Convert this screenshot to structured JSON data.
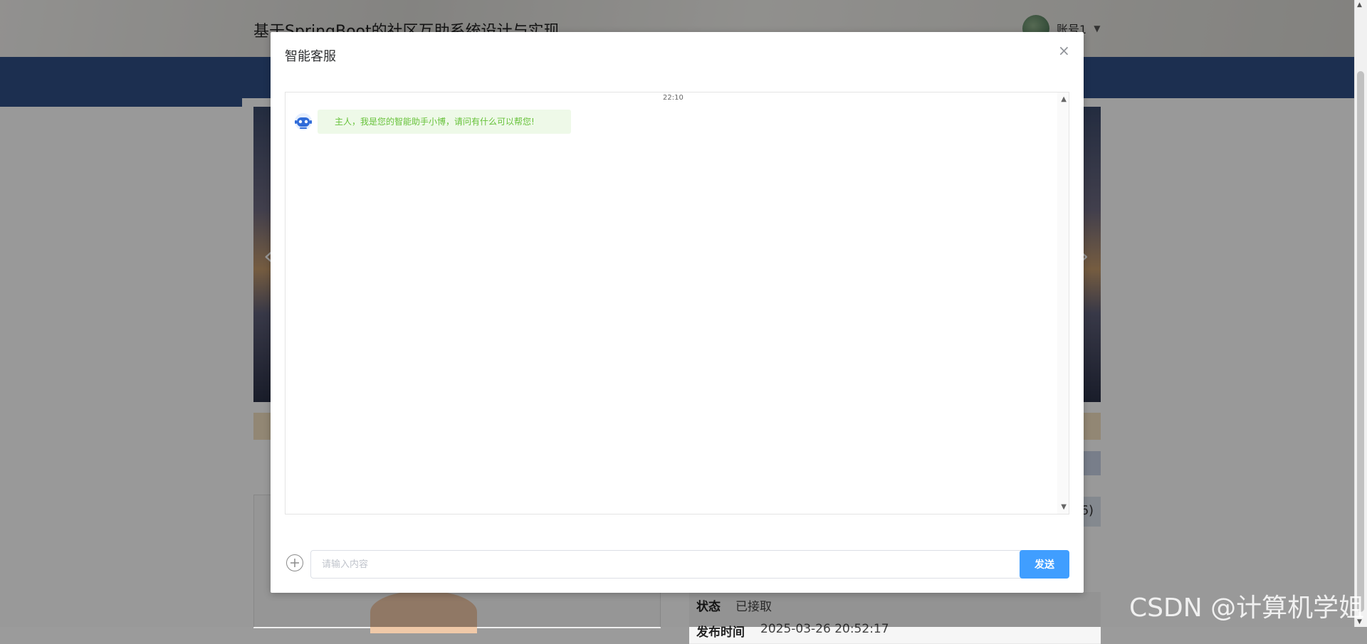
{
  "background": {
    "site_title": "基于SpringBoot的社区互助系统设计与实现",
    "user": {
      "name": "账号1",
      "caret": "▼"
    },
    "info_number": "6)",
    "info_rows": [
      {
        "label": "状态",
        "value": "已接取"
      },
      {
        "label": "发布时间",
        "value": "2025-03-26 20:52:17"
      }
    ]
  },
  "modal": {
    "title": "智能客服",
    "close_glyph": "×",
    "chat": {
      "time": "22:10",
      "messages": [
        {
          "from": "bot",
          "text": "主人，我是您的智能助手小博，请问有什么可以帮您!"
        }
      ]
    },
    "input_placeholder": "请输入内容",
    "send_label": "发送"
  },
  "watermark": "CSDN @计算机学姐",
  "colors": {
    "primary": "#409eff",
    "bot_text": "#67c23a",
    "bot_bubble": "#eef9e8",
    "nav": "#2f4f86"
  }
}
